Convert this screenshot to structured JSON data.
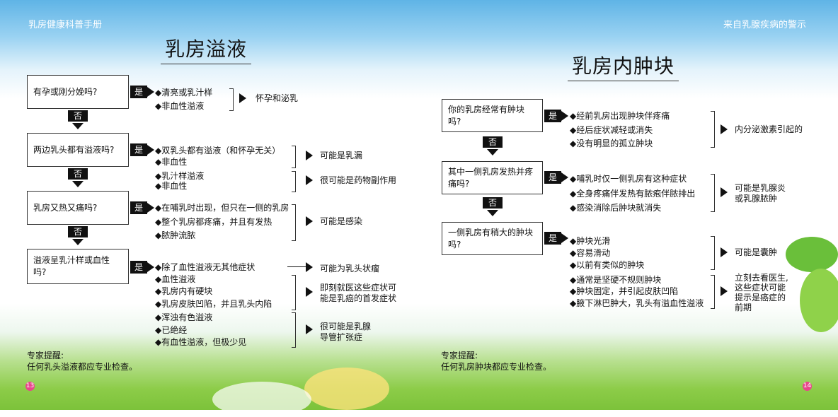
{
  "header": {
    "left": "乳房健康科普手册",
    "right": "来自乳腺疾病的警示"
  },
  "left": {
    "title": "乳房溢液",
    "yes_label": "是",
    "no_label": "否",
    "questions": [
      "有孕或刚分娩吗?",
      "两边乳头都有溢液吗?",
      "乳房又热又痛吗?",
      "溢液呈乳汁样或血性吗?"
    ],
    "options": [
      "◆清亮或乳汁样",
      "◆非血性溢液",
      "◆双乳头都有溢液（和怀孕无关）",
      "◆非血性",
      "◆乳汁样溢液",
      "◆非血性",
      "◆在哺乳时出现，但只在一侧的乳房",
      "◆整个乳房都疼痛，并且有发热",
      "◆脓肿流脓",
      "◆除了血性溢液无其他症状",
      "◆血性溢液",
      "◆乳房内有硬块",
      "◆乳房皮肤凹陷，并且乳头内陷",
      "◆浑浊有色溢液",
      "◆已绝经",
      "◆有血性溢液，但极少见"
    ],
    "results": [
      "怀孕和泌乳",
      "可能是乳漏",
      "很可能是药物副作用",
      "可能是感染",
      "可能为乳头状瘤",
      "即刻就医这些症状可",
      "能是乳癌的首发症状",
      "很可能是乳腺",
      "导管扩张症"
    ],
    "tip_title": "专家提醒:",
    "tip_text": "任何乳头溢液都应专业检查。",
    "page": "13"
  },
  "right": {
    "title": "乳房内肿块",
    "yes_label": "是",
    "no_label": "否",
    "questions": [
      "你的乳房经常有肿块吗?",
      "其中一侧乳房发热并疼",
      "痛吗?",
      "一侧乳房有稍大的肿块",
      "吗?"
    ],
    "options": [
      "◆经前乳房出现肿块伴疼痛",
      "◆经后症状减轻或消失",
      "◆没有明显的孤立肿块",
      "◆哺乳时仅一侧乳房有这种症状",
      "◆全身疼痛伴发热有脓疱伴脓排出",
      "◆感染消除后肿块就消失",
      "◆肿块光滑",
      "◆容易滑动",
      "◆以前有类似的肿块",
      "◆通常是坚硬不规则肿块",
      "◆肿块固定，并引起皮肤凹陷",
      "◆腋下淋巴肿大，乳头有溢血性溢液"
    ],
    "results": [
      "内分泌激素引起的",
      "可能是乳腺炎",
      "或乳腺脓肿",
      "可能是囊肿",
      "立刻去看医生,",
      "这些症状可能",
      "提示是癌症的",
      "前期"
    ],
    "tip_title": "专家提醒:",
    "tip_text": "任何乳房肿块都应专业检查。",
    "page": "14"
  },
  "colors": {
    "sky_top": "#5fb4e6",
    "grass": "#7cc23a",
    "page_badge": "#e8468b"
  }
}
